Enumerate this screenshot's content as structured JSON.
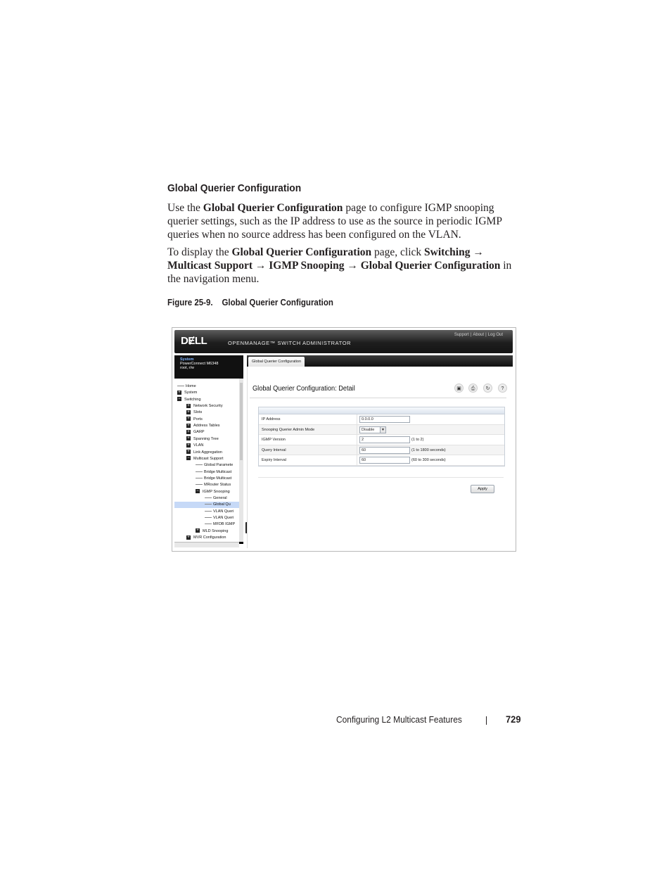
{
  "heading": "Global Querier Configuration",
  "intro": {
    "p1_a": "Use the ",
    "p1_b": "Global Querier Configuration",
    "p1_c": " page to configure IGMP snooping querier settings, such as the IP address to use as the source in periodic IGMP queries when no source address has been configured on the VLAN.",
    "p2_a": "To display the ",
    "p2_b": "Global Querier Configuration",
    "p2_c": " page, click ",
    "p2_d": "Switching → Multicast Support → IGMP Snooping → Global Querier Configuration",
    "p2_e": " in the navigation menu."
  },
  "figure": {
    "number": "Figure 25-9.",
    "title": "Global Querier Configuration"
  },
  "screenshot": {
    "logo": "DɆLL",
    "product": "OPENMANAGE™ SWITCH ADMINISTRATOR",
    "links": [
      "Support",
      "About",
      "Log Out"
    ],
    "system": {
      "title": "System",
      "model": "PowerConnect M6348",
      "user": "root, r/w"
    },
    "nav": [
      "Home",
      "System",
      "Switching",
      "Network Security",
      "Slots",
      "Ports",
      "Address Tables",
      "GARP",
      "Spanning Tree",
      "VLAN",
      "Link Aggregation",
      "Multicast Support",
      "Global Paramete",
      "Bridge Multicast",
      "Bridge Multicast",
      "MRouter Status",
      "IGMP Snooping",
      "General",
      "Global Qu",
      "VLAN Queri",
      "VLAN Queri",
      "MFDB IGMP",
      "MLD Snooping",
      "MVR Configuration"
    ],
    "tab": "Global Querier Configuration",
    "page_title": "Global Querier Configuration: Detail",
    "icons": [
      "save-icon",
      "print-icon",
      "refresh-icon",
      "help-icon"
    ],
    "fields": [
      {
        "label": "IP Address",
        "value": "0.0.0.0",
        "range": ""
      },
      {
        "label": "Snooping Querier Admin Mode",
        "value": "Disable",
        "range": ""
      },
      {
        "label": "IGMP Version",
        "value": "2",
        "range": "(1 to 2)"
      },
      {
        "label": "Query Interval",
        "value": "60",
        "range": "(1 to 1800 seconds)"
      },
      {
        "label": "Expiry Interval",
        "value": "60",
        "range": "(60 to 300 seconds)"
      }
    ],
    "apply": "Apply"
  },
  "footer": {
    "chapter": "Configuring L2 Multicast Features",
    "page": "729"
  }
}
